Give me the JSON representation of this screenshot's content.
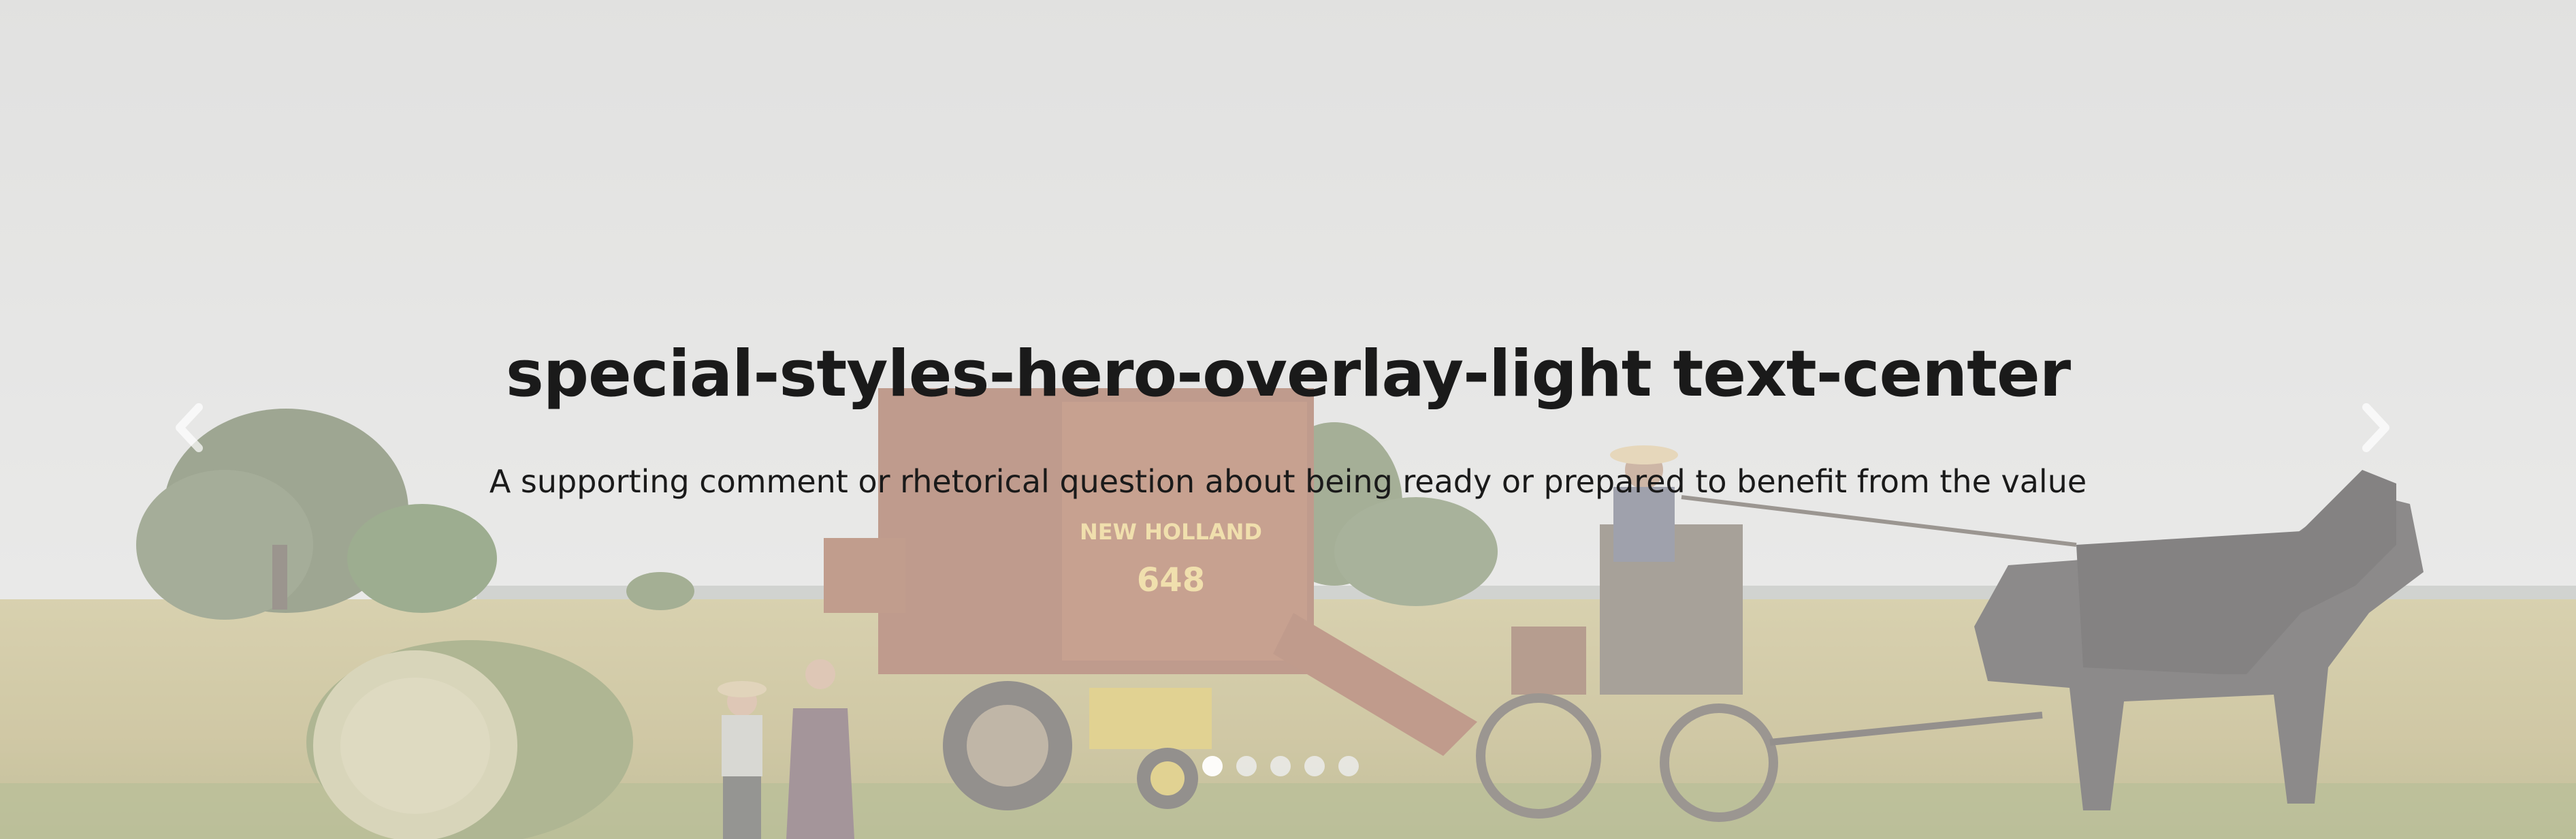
{
  "hero": {
    "title": "special-styles-hero-overlay-light text-center",
    "subtitle": "A supporting comment or rhetorical question about being ready or prepared to benefit from the value",
    "overlay_color": "#ffffff",
    "text_color": "#1a1a1a",
    "background_image": "farm-field-hay-baler-horses-photo",
    "baler_text": [
      "NEW HOLLAND",
      "648"
    ]
  },
  "carousel": {
    "prev_icon": "chevron-left-icon",
    "next_icon": "chevron-right-icon",
    "indicator_count": 5,
    "active_index": 0
  }
}
